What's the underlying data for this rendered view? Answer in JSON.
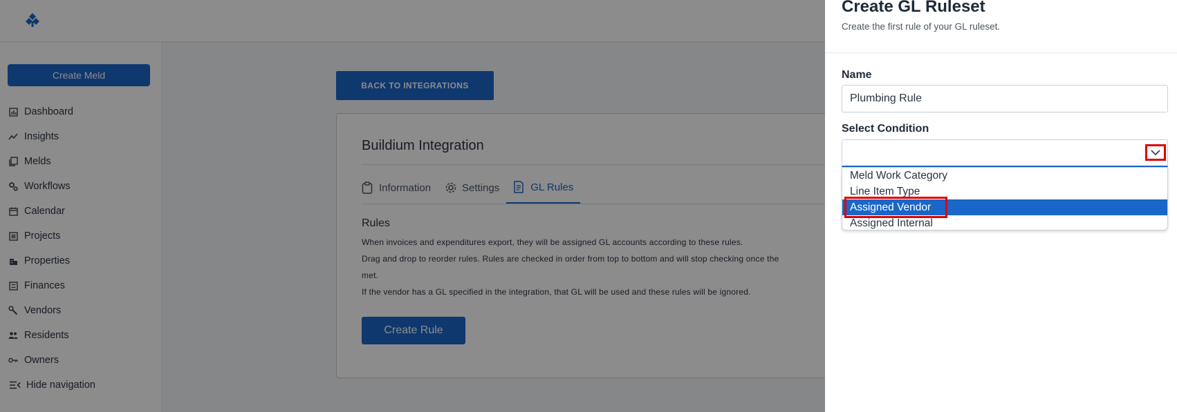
{
  "sidebar": {
    "create_meld": "Create Meld",
    "items": [
      {
        "label": "Dashboard",
        "icon": "dashboard-icon"
      },
      {
        "label": "Insights",
        "icon": "insights-icon"
      },
      {
        "label": "Melds",
        "icon": "melds-icon"
      },
      {
        "label": "Workflows",
        "icon": "workflows-icon"
      },
      {
        "label": "Calendar",
        "icon": "calendar-icon"
      },
      {
        "label": "Projects",
        "icon": "projects-icon"
      },
      {
        "label": "Properties",
        "icon": "properties-icon"
      },
      {
        "label": "Finances",
        "icon": "finances-icon"
      },
      {
        "label": "Vendors",
        "icon": "vendors-icon"
      },
      {
        "label": "Residents",
        "icon": "residents-icon"
      },
      {
        "label": "Owners",
        "icon": "owners-icon"
      }
    ],
    "hide_navigation": "Hide navigation"
  },
  "main": {
    "back_button": "BACK TO INTEGRATIONS",
    "card_title": "Buildium Integration",
    "tabs": [
      {
        "label": "Information",
        "icon": "clipboard-icon"
      },
      {
        "label": "Settings",
        "icon": "gear-icon"
      },
      {
        "label": "GL Rules",
        "icon": "document-icon"
      }
    ],
    "rules_heading": "Rules",
    "rules_lines": [
      "When invoices and expenditures export, they will be assigned GL accounts according to these rules.",
      "Drag and drop to reorder rules. Rules are checked in order from top to bottom and will stop checking once the",
      "met.",
      "If the vendor has a GL specified in the integration, that GL will be used and these rules will be ignored."
    ],
    "create_rule": "Create Rule"
  },
  "panel": {
    "title": "Create GL Ruleset",
    "subtitle": "Create the first rule of your GL ruleset.",
    "name_label": "Name",
    "name_value": "Plumbing Rule",
    "condition_label": "Select Condition",
    "options": [
      "Meld Work Category",
      "Line Item Type",
      "Assigned Vendor",
      "Assigned Internal"
    ],
    "selected_option": "Assigned Vendor"
  },
  "colors": {
    "accent": "#1a66c9",
    "highlight": "#e00000"
  }
}
